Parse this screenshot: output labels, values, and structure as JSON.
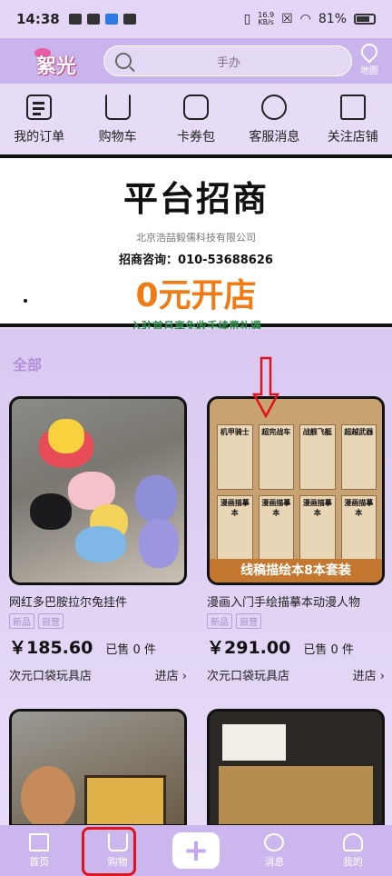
{
  "status_bar": {
    "time": "14:38",
    "net_speed_top": "16.9",
    "net_speed_bottom": "KB/s",
    "battery": "81%"
  },
  "header": {
    "logo_text": "絮光",
    "search_placeholder": "手办",
    "map_label": "地图"
  },
  "quick_actions": [
    {
      "label": "我的订单",
      "icon": "order-icon"
    },
    {
      "label": "购物车",
      "icon": "cart-icon"
    },
    {
      "label": "卡券包",
      "icon": "coupon-icon"
    },
    {
      "label": "客服消息",
      "icon": "chat-icon"
    },
    {
      "label": "关注店铺",
      "icon": "store-icon"
    }
  ],
  "banner": {
    "title": "平台招商",
    "company": "北京浩喆毅儒科技有限公司",
    "phone": "招商咨询：010-53688626",
    "headline": "0元开店",
    "note": "入驻首月享免收手续费礼遇"
  },
  "section_label": "全部",
  "products": [
    {
      "name": "网红多巴胺拉尔兔挂件",
      "tags": [
        "新品",
        "自营"
      ],
      "price": "￥185.60",
      "sold": "已售 0 件",
      "store": "次元口袋玩具店",
      "enter": "进店 ›"
    },
    {
      "name": "漫画入门手绘描摹本动漫人物",
      "tags": [
        "新品",
        "自营"
      ],
      "price": "￥291.00",
      "sold": "已售 0 件",
      "store": "次元口袋玩具店",
      "enter": "进店 ›",
      "image_band": "线稿描绘本8本套装",
      "book_titles": [
        "机甲骑士",
        "超完战车",
        "战舰飞艇",
        "超越武器",
        "漫画描摹本",
        "漫画描摹本",
        "漫画描摹本",
        "漫画描摹本"
      ]
    }
  ],
  "nav": {
    "home": "首页",
    "shop": "购物",
    "messages": "消息",
    "me": "我的",
    "add": "+"
  },
  "colors": {
    "accent": "#c9b4ec",
    "price": "#111111",
    "banner_orange": "#f07a14",
    "highlight_red": "#e0121a"
  }
}
